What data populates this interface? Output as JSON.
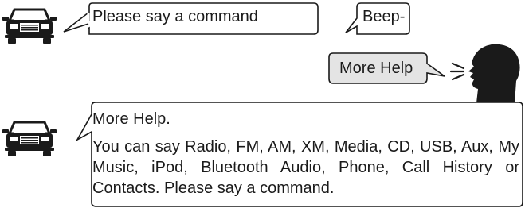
{
  "dialog": {
    "system_prompt": "Please say a command",
    "beep": "Beep-",
    "user_utterance": "More Help",
    "system_response_title": "More Help.",
    "system_response_body": "You can say Radio, FM, AM, XM, Media, CD, USB, Aux, My Music, iPod, Bluetooth Audio, Phone, Call History or Contacts. Please say a command."
  },
  "icons": {
    "car": "car-icon",
    "speaker": "speaking-head-icon"
  },
  "colors": {
    "stroke": "#1a1a1a",
    "user_bubble_fill": "#e4e4e4",
    "bubble_fill": "#ffffff"
  }
}
